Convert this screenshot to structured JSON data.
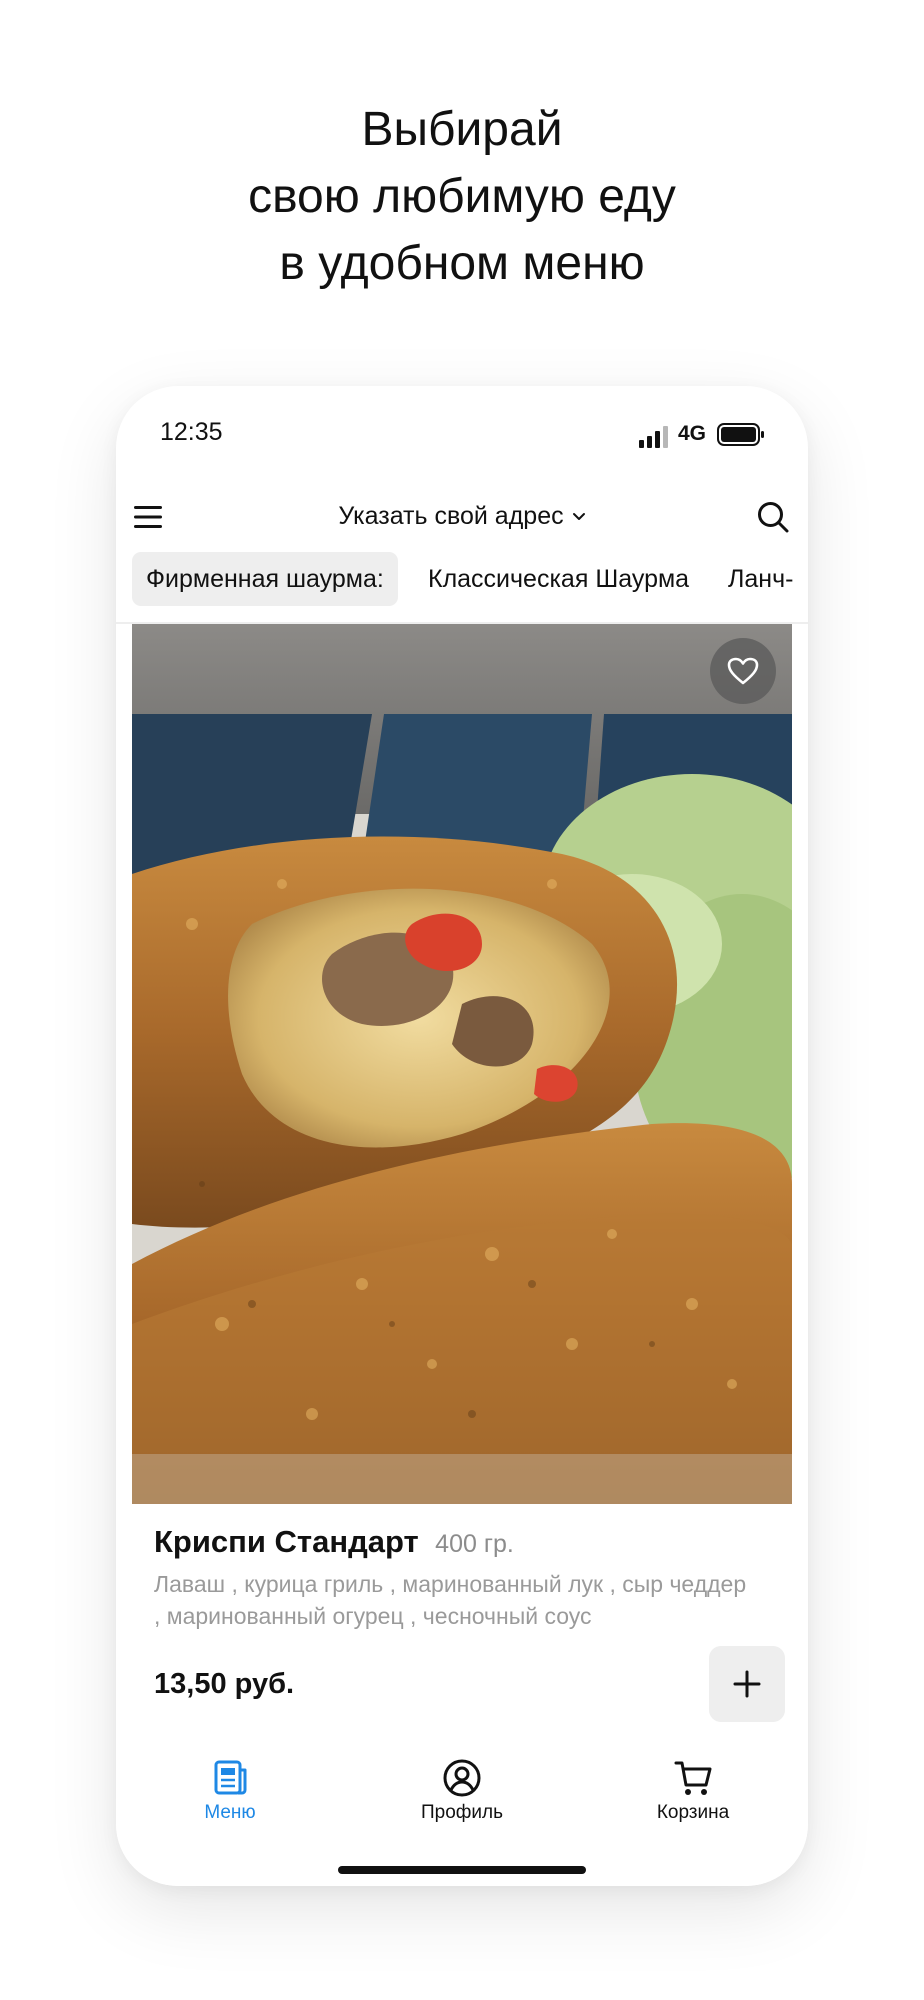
{
  "headline": {
    "lines": [
      "Выбирай",
      "свою любимую еду",
      "в удобном меню"
    ]
  },
  "status_bar": {
    "time": "12:35",
    "network": "4G",
    "icons": [
      "signal-icon",
      "battery-icon"
    ]
  },
  "top_bar": {
    "menu_icon": "hamburger-menu-icon",
    "address_label": "Указать свой адрес",
    "address_icon": "chevron-down-icon",
    "search_icon": "search-icon"
  },
  "category_tabs": [
    {
      "label": "Фирменная шаурма:",
      "active": true
    },
    {
      "label": "Классическая Шаурма",
      "active": false
    },
    {
      "label": "Ланч-",
      "active": false
    }
  ],
  "product": {
    "name": "Криспи Стандарт",
    "weight": "400 гр.",
    "description": "Лаваш , курица гриль , маринованный лук , сыр чеддер , маринованный огурец , чесночный соус",
    "price": "13,50 руб.",
    "favorite_icon": "heart-icon",
    "add_icon": "plus-icon"
  },
  "tab_bar": [
    {
      "label": "Меню",
      "icon": "menu-document-icon",
      "active": true
    },
    {
      "label": "Профиль",
      "icon": "profile-icon",
      "active": false
    },
    {
      "label": "Корзина",
      "icon": "cart-icon",
      "active": false
    }
  ],
  "colors": {
    "accent": "#1e88e5",
    "text": "#111111",
    "secondary_text": "#9a9a9a",
    "chip_background": "#eeeeee"
  }
}
